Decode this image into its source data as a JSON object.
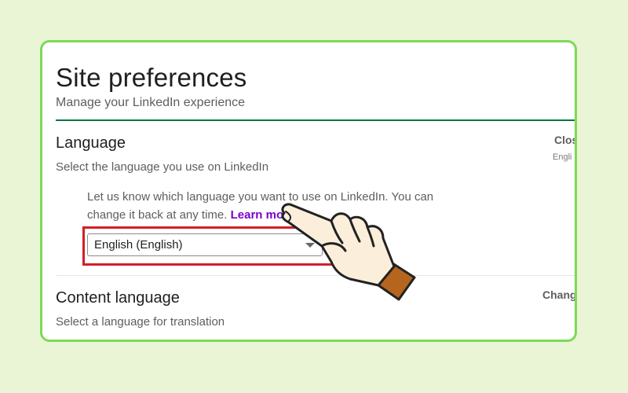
{
  "page": {
    "title": "Site preferences",
    "subtitle": "Manage your LinkedIn experience"
  },
  "language_section": {
    "title": "Language",
    "description": "Select the language you use on LinkedIn",
    "action_link": "Clos",
    "action_subtext": "Engli",
    "help_text": "Let us know which language you want to use on LinkedIn. You can change it back at any time.",
    "learn_more": "Learn more",
    "select": {
      "selected_value": "English (English)"
    }
  },
  "content_language_section": {
    "title": "Content language",
    "description": "Select a language for translation",
    "action_link": "Chang"
  },
  "colors": {
    "background": "#e9f5d5",
    "card_border": "#7ed957",
    "accent_green": "#057642",
    "link_purple": "#7a00cc",
    "highlight_red": "#d21f2a"
  },
  "icons": {
    "pointer": "pointing-hand-icon",
    "dropdown": "caret-down-icon"
  }
}
